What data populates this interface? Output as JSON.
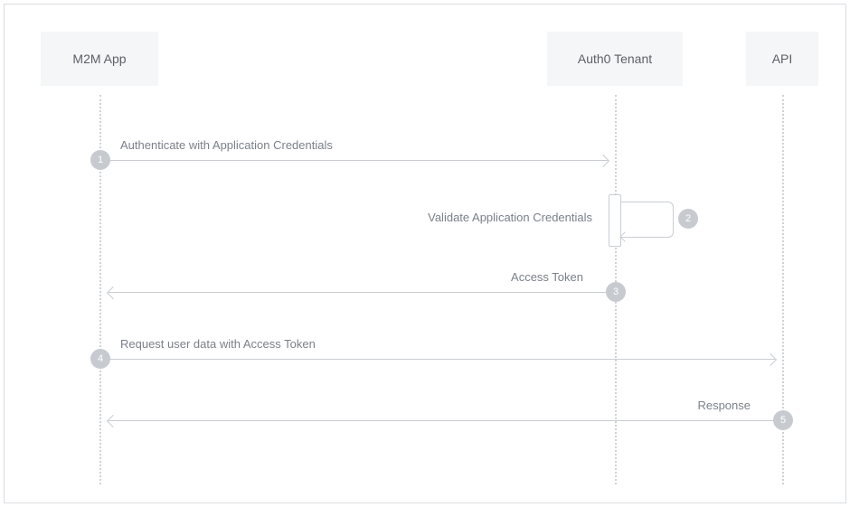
{
  "participants": {
    "m2m": "M2M App",
    "tenant": "Auth0 Tenant",
    "api": "API"
  },
  "steps": {
    "s1": {
      "num": "1",
      "label": "Authenticate with Application Credentials"
    },
    "s2": {
      "num": "2",
      "label": "Validate Application Credentials"
    },
    "s3": {
      "num": "3",
      "label": "Access Token"
    },
    "s4": {
      "num": "4",
      "label": "Request user data with Access Token"
    },
    "s5": {
      "num": "5",
      "label": "Response"
    }
  }
}
